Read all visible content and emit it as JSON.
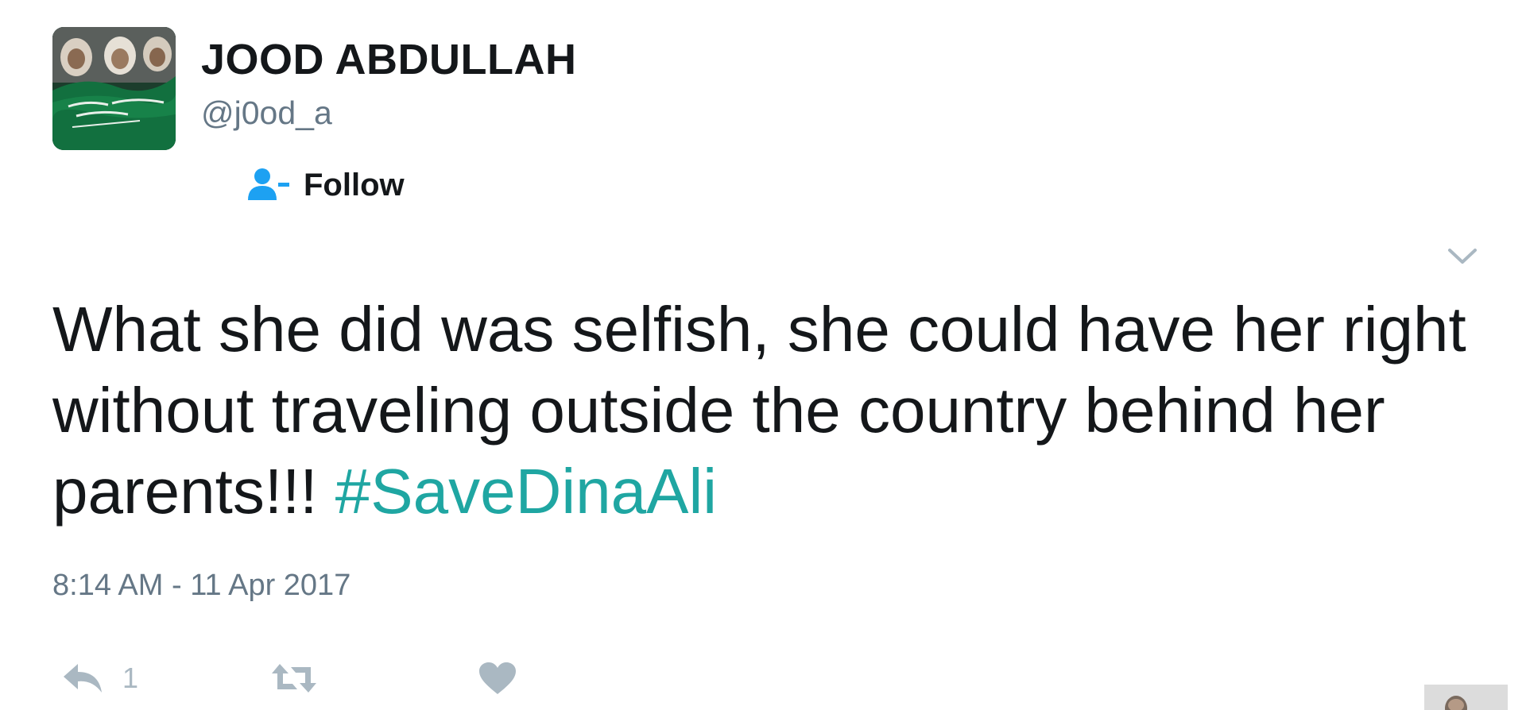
{
  "user": {
    "display_name": "JOOD ABDULLAH",
    "handle": "@j0od_a"
  },
  "follow_button": {
    "label": "Follow"
  },
  "tweet": {
    "text": "What she did was selfish, she could have her right without traveling outside the country behind her parents!!! ",
    "hashtag": "#SaveDinaAli",
    "timestamp": "8:14 AM - 11 Apr 2017"
  },
  "actions": {
    "reply_count": "1",
    "retweet_count": "",
    "like_count": ""
  },
  "colors": {
    "text": "#14171a",
    "secondary": "#657786",
    "hashtag": "#1fa6a2",
    "follow_icon": "#1da1f2",
    "action_icon": "#aab8c2"
  },
  "icons": {
    "follow": "follow-user-icon",
    "caret": "chevron-down-icon",
    "reply": "reply-icon",
    "retweet": "retweet-icon",
    "like": "heart-icon"
  }
}
